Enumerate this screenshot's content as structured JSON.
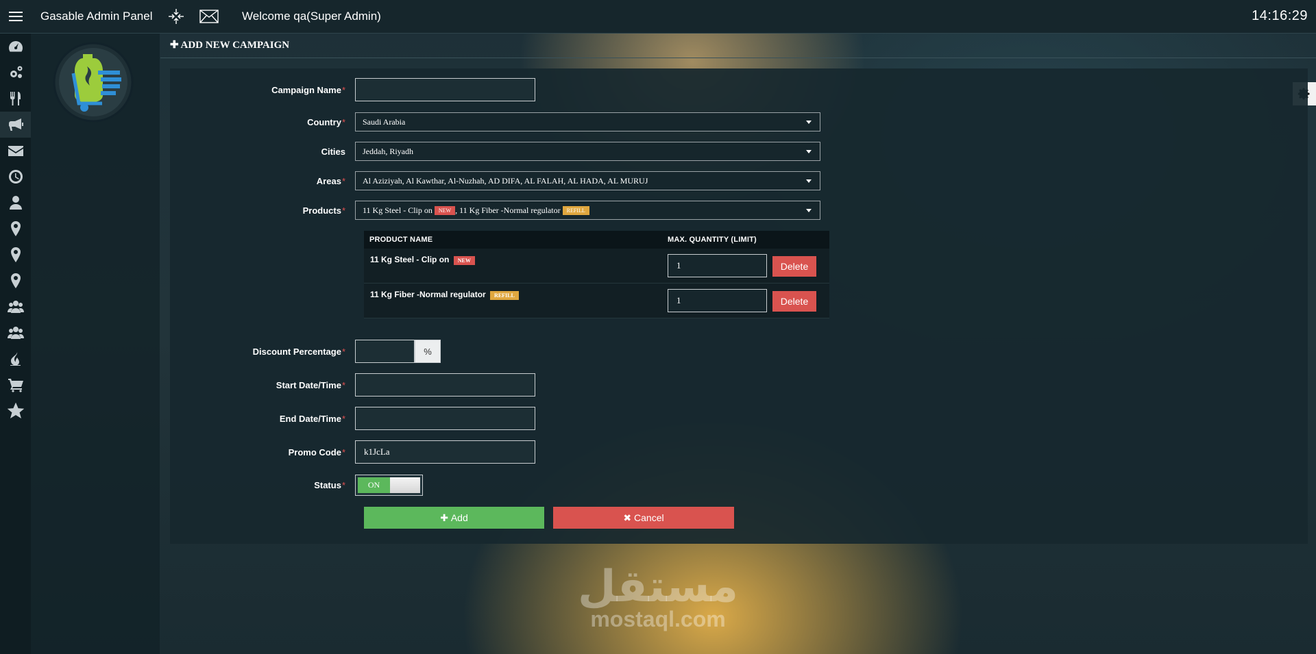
{
  "app": {
    "title": "Gasable Admin Panel",
    "welcome": "Welcome qa(Super Admin)",
    "clock": "14:16:29"
  },
  "page": {
    "heading": "ADD NEW CAMPAIGN"
  },
  "sidebar_icons": [
    "dashboard-icon",
    "settings-gears-icon",
    "food-icon",
    "megaphone-icon",
    "envelope-icon",
    "clock-icon",
    "user-icon",
    "map-marker-icon",
    "map-marker-icon",
    "map-marker-icon",
    "users-icon",
    "users-icon",
    "fire-icon",
    "cart-icon",
    "star-icon"
  ],
  "form": {
    "required_mark": "*",
    "campaign_name": {
      "label": "Campaign Name",
      "value": ""
    },
    "country": {
      "label": "Country",
      "value": "Saudi Arabia"
    },
    "cities": {
      "label": "Cities",
      "value": "Jeddah, Riyadh"
    },
    "areas": {
      "label": "Areas",
      "value": "Al Aziziyah, Al Kawthar, Al-Nuzhah, AD DIFA, AL FALAH, AL HADA, AL MURUJ"
    },
    "products": {
      "label": "Products",
      "item1": "11 Kg Steel - Clip on",
      "badge1": "NEW",
      "separator": ",",
      "item2": "11 Kg Fiber -Normal regulator",
      "badge2": "REFILL"
    },
    "product_table": {
      "col_name": "PRODUCT NAME",
      "col_qty": "MAX. QUANTITY (LIMIT)",
      "rows": [
        {
          "name": "11 Kg Steel - Clip on",
          "badge": "NEW",
          "qty": "1",
          "delete": "Delete"
        },
        {
          "name": "11 Kg Fiber -Normal regulator",
          "badge": "REFILL",
          "qty": "1",
          "delete": "Delete"
        }
      ]
    },
    "discount": {
      "label": "Discount Percentage",
      "value": "",
      "addon": "%"
    },
    "start": {
      "label": "Start Date/Time",
      "value": ""
    },
    "end": {
      "label": "End Date/Time",
      "value": ""
    },
    "promo": {
      "label": "Promo Code",
      "value": "k1JcLa"
    },
    "status": {
      "label": "Status",
      "on_label": "ON"
    },
    "add_button": "Add",
    "cancel_button": "Cancel"
  },
  "watermark": {
    "arabic": "مستقل",
    "latin": "mostaql.com"
  },
  "colors": {
    "success": "#5cb85c",
    "danger": "#d9534f",
    "warning": "#e0a73f",
    "topbar": "#16262c"
  }
}
